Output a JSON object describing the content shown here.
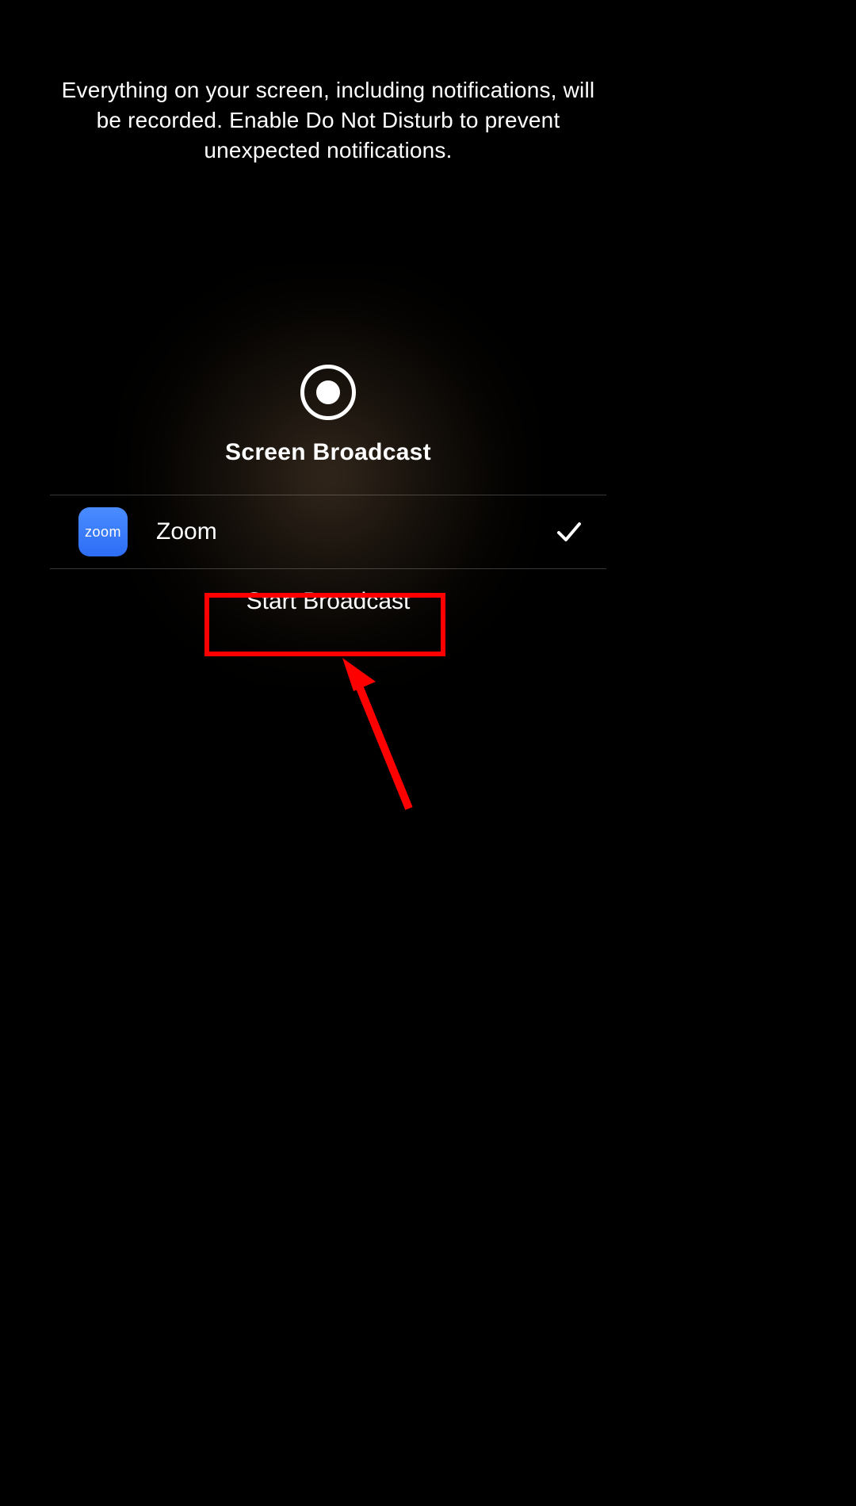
{
  "warning": "Everything on your screen, including notifications, will be recorded. Enable Do Not Disturb to prevent unexpected notifications.",
  "broadcast": {
    "title": "Screen Broadcast",
    "start_label": "Start Broadcast"
  },
  "app": {
    "name": "Zoom",
    "icon_text": "zoom",
    "selected": true
  },
  "annotation": {
    "highlight_color": "#ff0000"
  }
}
